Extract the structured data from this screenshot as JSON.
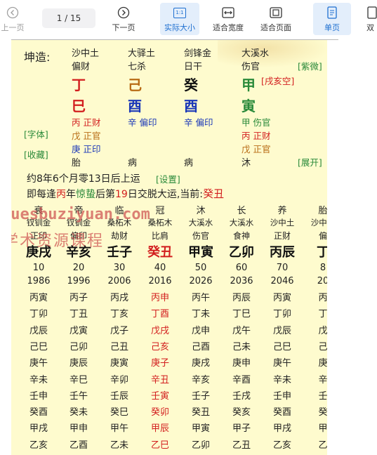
{
  "toolbar": {
    "prev": "上一页",
    "page_display": "1 / 15",
    "next": "下一页",
    "actual_size": "实际大小",
    "fit_width": "适合宽度",
    "fit_page": "适合页面",
    "single_page": "单页",
    "double_page": "双",
    "icon_text": "1:1"
  },
  "chart": {
    "label": "坤造:",
    "nayin": [
      "沙中土",
      "大驿土",
      "剑锋金",
      "大溪水"
    ],
    "shishen": [
      "偏财",
      "七杀",
      "日干",
      "伤官"
    ],
    "tiangan": [
      "丁",
      "己",
      "癸",
      "甲"
    ],
    "dizhi": [
      "巳",
      "酉",
      "酉",
      "寅"
    ],
    "kongwang": "[戌亥空]",
    "ziwei": "[紫微]",
    "canggan_col1": [
      "丙 正财",
      "戊 正官",
      "庚 正印"
    ],
    "canggan_col2": [
      "辛 偏印"
    ],
    "canggan_col3": [
      "辛 偏印"
    ],
    "canggan_col4": [
      "甲 伤官",
      "丙 正财",
      "戊 正官"
    ],
    "font_link": "[字体]",
    "collect_link": "[收藏]",
    "changsheng": [
      "胎",
      "病",
      "病",
      "沐"
    ],
    "expand_link": "[展开]",
    "qiyun": "约8年6个月零13日后上运",
    "setting_link": "[设置]",
    "jiaoyun_prefix": "即每逢",
    "jiaoyun_year": "丙",
    "jiaoyun_mid1": "年",
    "jiaoyun_jieqi": "惊蛰",
    "jiaoyun_mid2": "后第",
    "jiaoyun_day": "19",
    "jiaoyun_suffix": "日交脱大运,当前:",
    "jiaoyun_current": "癸丑"
  },
  "dayun": {
    "changsheng": [
      "衰",
      "帝",
      "临",
      "冠",
      "沐",
      "长",
      "养",
      "胎"
    ],
    "nayin": [
      "钗钏金",
      "钗钏金",
      "桑柘木",
      "桑柘木",
      "大溪水",
      "大溪水",
      "沙中土",
      "沙中土"
    ],
    "shishen": [
      "正印",
      "偏印",
      "劫财",
      "比肩",
      "伤官",
      "食神",
      "正财",
      "偏"
    ],
    "ganzhi": [
      "庚戌",
      "辛亥",
      "壬子",
      "癸丑",
      "甲寅",
      "乙卯",
      "丙辰",
      "丁"
    ],
    "ages": [
      "10",
      "20",
      "30",
      "40",
      "50",
      "60",
      "70",
      "8"
    ],
    "years": [
      "1986",
      "1996",
      "2006",
      "2016",
      "2026",
      "2036",
      "2046",
      "20"
    ],
    "liunian": [
      [
        "丙寅",
        "丙子",
        "丙戌",
        "丙申",
        "丙午",
        "丙辰",
        "丙寅",
        "丙"
      ],
      [
        "丁卯",
        "丁丑",
        "丁亥",
        "丁酉",
        "丁未",
        "丁巳",
        "丁卯",
        "丁"
      ],
      [
        "戊辰",
        "戊寅",
        "戊子",
        "戊戌",
        "戊申",
        "戊午",
        "戊辰",
        "戊"
      ],
      [
        "己巳",
        "己卯",
        "己丑",
        "己亥",
        "己酉",
        "己未",
        "己巳",
        "己"
      ],
      [
        "庚午",
        "庚辰",
        "庚寅",
        "庚子",
        "庚戌",
        "庚申",
        "庚午",
        "庚"
      ],
      [
        "辛未",
        "辛巳",
        "辛卯",
        "辛丑",
        "辛亥",
        "辛酉",
        "辛未",
        "辛"
      ],
      [
        "壬申",
        "壬午",
        "壬辰",
        "壬寅",
        "壬子",
        "壬戌",
        "壬申",
        "壬"
      ],
      [
        "癸酉",
        "癸未",
        "癸巳",
        "癸卯",
        "癸丑",
        "癸亥",
        "癸酉",
        "癸"
      ],
      [
        "甲戌",
        "甲申",
        "甲午",
        "甲辰",
        "甲寅",
        "甲子",
        "甲戌",
        "甲"
      ],
      [
        "乙亥",
        "乙酉",
        "乙未",
        "乙巳",
        "乙卯",
        "乙丑",
        "乙亥",
        "乙"
      ]
    ]
  },
  "watermark": {
    "line1": "xuesbuziyuan.com",
    "line2": "学术资源课程"
  },
  "colors": {
    "accent": "#1e6fd0",
    "page_bg": "#fefbce",
    "green": "#2a8a3a",
    "blue": "#1a37b8",
    "red": "#d21e1e",
    "brown": "#b86b14"
  }
}
